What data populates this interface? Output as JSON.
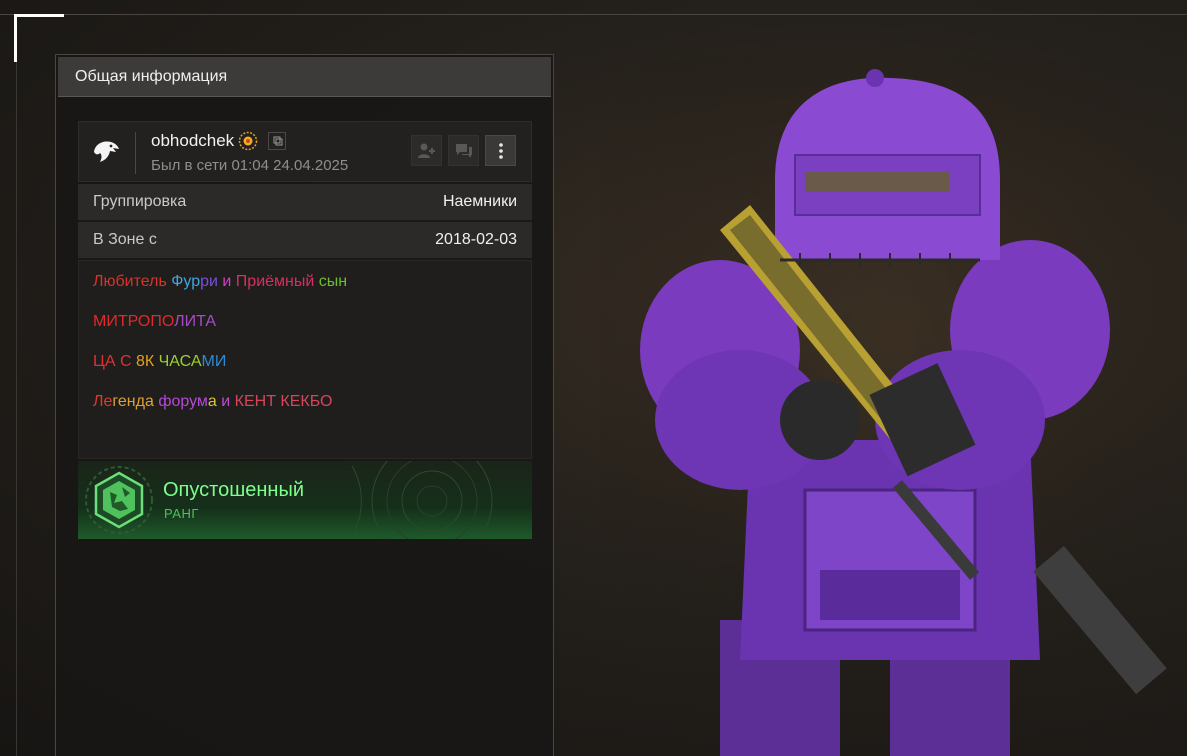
{
  "panel": {
    "title": "Общая информация"
  },
  "user": {
    "name": "obhodchek",
    "status": "Был в сети 01:04 24.04.2025",
    "avatar_icon": "eagle-icon",
    "badge_icon": "sun-badge-icon"
  },
  "actions": [
    {
      "icon": "add-friend-icon"
    },
    {
      "icon": "chat-icon"
    },
    {
      "icon": "more-vertical-icon"
    }
  ],
  "info": {
    "faction_label": "Группировка",
    "faction_value": "Наемники",
    "zone_label": "В Зоне с",
    "zone_value": "2018-02-03"
  },
  "bio": {
    "line1": [
      {
        "t": "Любитель ",
        "c": "#d6342a"
      },
      {
        "t": "Фур",
        "c": "#3da7e0"
      },
      {
        "t": "ри",
        "c": "#7a4de0"
      },
      {
        "t": " и ",
        "c": "#d63cc8"
      },
      {
        "t": "Приёмный ",
        "c": "#d63060"
      },
      {
        "t": "сын",
        "c": "#6bbf2a"
      }
    ],
    "line2": [
      {
        "t": "МИТРОПО",
        "c": "#e02a2a"
      },
      {
        "t": "ЛИТА",
        "c": "#a64ac9"
      }
    ],
    "line3": [
      {
        "t": "ЦА С ",
        "c": "#e03030"
      },
      {
        "t": "8К ",
        "c": "#e0a020"
      },
      {
        "t": "ЧАСА",
        "c": "#9ad030"
      },
      {
        "t": "МИ",
        "c": "#2a8ad6"
      }
    ],
    "line4": [
      {
        "t": "Ле",
        "c": "#e03a2a"
      },
      {
        "t": "генда ",
        "c": "#e0a030"
      },
      {
        "t": "форум",
        "c": "#b44ad6"
      },
      {
        "t": "а",
        "c": "#e0c030"
      },
      {
        "t": " и ",
        "c": "#c04ad0"
      },
      {
        "t": "КЕНТ КЕКБО",
        "c": "#d6455a"
      }
    ]
  },
  "rank": {
    "name": "Опустошенный",
    "label": "РАНГ"
  },
  "colors": {
    "rank_text": "#7dff8d",
    "armor": "#7a3bbf",
    "panel": "#181716"
  }
}
